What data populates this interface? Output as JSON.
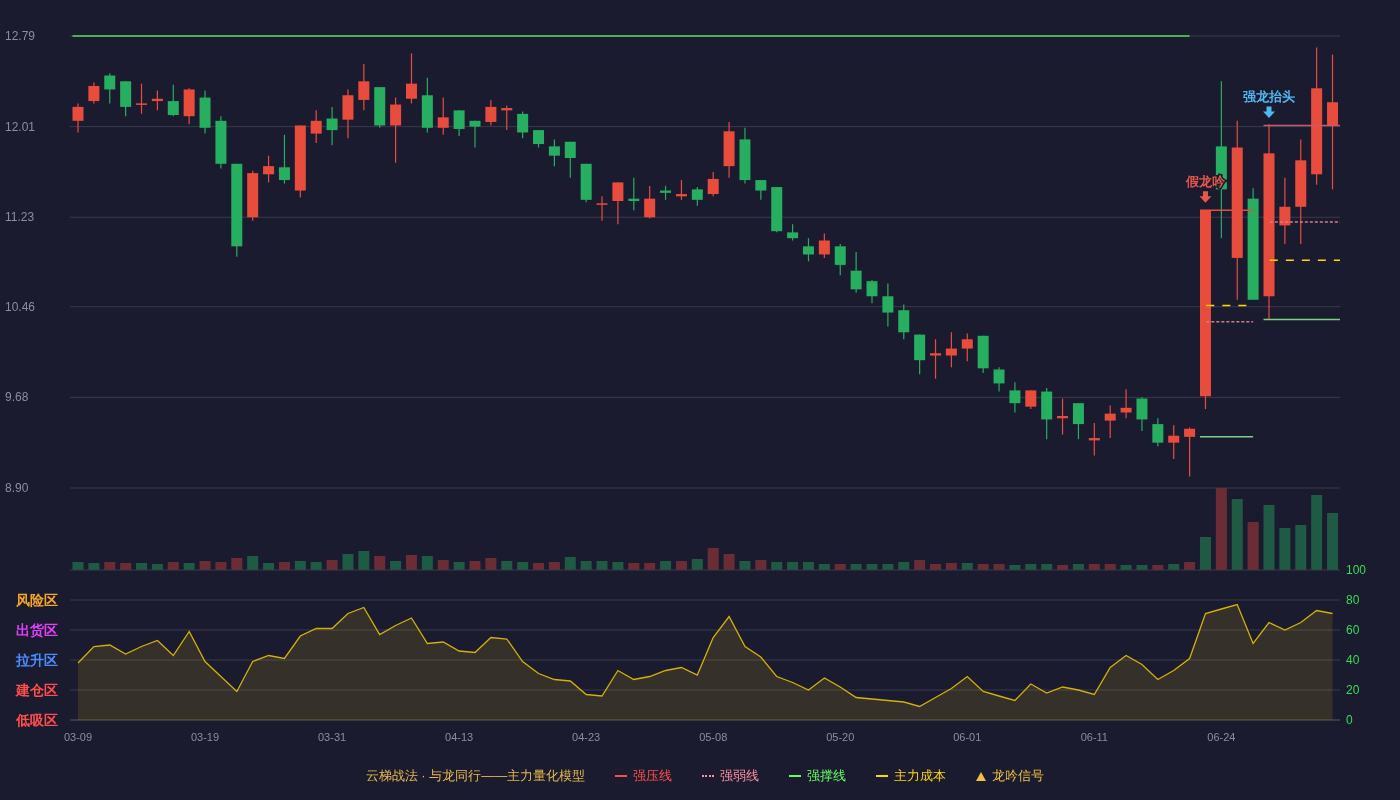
{
  "price_chart": {
    "chart_data": {
      "type": "candlestick",
      "ylim": [
        8.9,
        12.79
      ],
      "grid": true,
      "yticks": [
        {
          "value": 12.79,
          "label": "12.79"
        },
        {
          "value": 12.01,
          "label": "12.01"
        },
        {
          "value": 11.23,
          "label": "11.23"
        },
        {
          "value": 10.46,
          "label": "10.46"
        },
        {
          "value": 9.68,
          "label": "9.68"
        },
        {
          "value": 8.9,
          "label": "8.90"
        }
      ],
      "ohlc": [
        [
          12.06,
          12.21,
          11.96,
          12.18
        ],
        [
          12.23,
          12.39,
          12.21,
          12.36
        ],
        [
          12.45,
          12.47,
          12.21,
          12.33
        ],
        [
          12.4,
          12.4,
          12.1,
          12.18
        ],
        [
          12.2,
          12.38,
          12.12,
          12.21
        ],
        [
          12.23,
          12.32,
          12.15,
          12.25
        ],
        [
          12.23,
          12.37,
          12.1,
          12.11
        ],
        [
          12.1,
          12.34,
          12.03,
          12.33
        ],
        [
          12.26,
          12.32,
          11.95,
          12.0
        ],
        [
          12.06,
          12.1,
          11.65,
          11.69
        ],
        [
          11.69,
          11.69,
          10.89,
          10.98
        ],
        [
          11.23,
          11.63,
          11.2,
          11.61
        ],
        [
          11.6,
          11.76,
          11.53,
          11.67
        ],
        [
          11.66,
          11.94,
          11.52,
          11.55
        ],
        [
          11.46,
          12.02,
          11.4,
          12.02
        ],
        [
          11.95,
          12.15,
          11.87,
          12.06
        ],
        [
          12.08,
          12.18,
          11.85,
          11.98
        ],
        [
          12.07,
          12.33,
          11.91,
          12.28
        ],
        [
          12.24,
          12.55,
          12.15,
          12.4
        ],
        [
          12.35,
          12.35,
          12.0,
          12.02
        ],
        [
          12.02,
          12.26,
          11.7,
          12.2
        ],
        [
          12.25,
          12.64,
          12.21,
          12.38
        ],
        [
          12.28,
          12.43,
          11.96,
          12.0
        ],
        [
          12.0,
          12.26,
          11.94,
          12.09
        ],
        [
          12.15,
          12.15,
          11.93,
          11.99
        ],
        [
          12.06,
          12.06,
          11.83,
          12.01
        ],
        [
          12.05,
          12.24,
          12.02,
          12.18
        ],
        [
          12.15,
          12.19,
          11.98,
          12.17
        ],
        [
          12.12,
          12.14,
          11.91,
          11.96
        ],
        [
          11.98,
          11.98,
          11.83,
          11.86
        ],
        [
          11.84,
          11.9,
          11.67,
          11.76
        ],
        [
          11.88,
          11.88,
          11.57,
          11.74
        ],
        [
          11.69,
          11.69,
          11.36,
          11.38
        ],
        [
          11.34,
          11.41,
          11.2,
          11.35
        ],
        [
          11.37,
          11.53,
          11.17,
          11.53
        ],
        [
          11.39,
          11.57,
          11.29,
          11.37
        ],
        [
          11.23,
          11.5,
          11.22,
          11.39
        ],
        [
          11.46,
          11.5,
          11.38,
          11.44
        ],
        [
          11.41,
          11.55,
          11.38,
          11.43
        ],
        [
          11.47,
          11.49,
          11.33,
          11.38
        ],
        [
          11.43,
          11.62,
          11.41,
          11.56
        ],
        [
          11.67,
          12.05,
          11.57,
          11.97
        ],
        [
          11.9,
          12.0,
          11.52,
          11.55
        ],
        [
          11.55,
          11.55,
          11.38,
          11.46
        ],
        [
          11.49,
          11.49,
          11.1,
          11.11
        ],
        [
          11.1,
          11.17,
          11.03,
          11.05
        ],
        [
          10.98,
          11.05,
          10.85,
          10.91
        ],
        [
          10.91,
          11.09,
          10.88,
          11.03
        ],
        [
          10.98,
          11.0,
          10.73,
          10.82
        ],
        [
          10.77,
          10.93,
          10.58,
          10.61
        ],
        [
          10.68,
          10.69,
          10.49,
          10.55
        ],
        [
          10.55,
          10.66,
          10.29,
          10.41
        ],
        [
          10.43,
          10.48,
          10.18,
          10.24
        ],
        [
          10.22,
          10.22,
          9.88,
          10.0
        ],
        [
          10.04,
          10.18,
          9.84,
          10.06
        ],
        [
          10.04,
          10.24,
          9.94,
          10.1
        ],
        [
          10.1,
          10.23,
          9.99,
          10.18
        ],
        [
          10.21,
          10.21,
          9.89,
          9.93
        ],
        [
          9.92,
          9.94,
          9.73,
          9.8
        ],
        [
          9.74,
          9.81,
          9.55,
          9.63
        ],
        [
          9.6,
          9.74,
          9.58,
          9.74
        ],
        [
          9.73,
          9.76,
          9.32,
          9.49
        ],
        [
          9.5,
          9.67,
          9.36,
          9.52
        ],
        [
          9.63,
          9.63,
          9.32,
          9.45
        ],
        [
          9.31,
          9.46,
          9.18,
          9.33
        ],
        [
          9.48,
          9.61,
          9.33,
          9.54
        ],
        [
          9.55,
          9.75,
          9.5,
          9.59
        ],
        [
          9.67,
          9.68,
          9.39,
          9.49
        ],
        [
          9.45,
          9.5,
          9.26,
          9.29
        ],
        [
          9.29,
          9.44,
          9.15,
          9.35
        ],
        [
          9.34,
          9.42,
          9.0,
          9.41
        ],
        [
          9.69,
          11.29,
          9.58,
          11.29
        ],
        [
          11.84,
          12.4,
          11.05,
          11.47
        ],
        [
          10.88,
          12.06,
          10.52,
          11.83
        ],
        [
          11.39,
          11.48,
          10.52,
          10.52
        ],
        [
          10.55,
          12.03,
          10.35,
          11.78
        ],
        [
          11.16,
          11.57,
          11.0,
          11.32
        ],
        [
          11.32,
          11.9,
          11.0,
          11.72
        ],
        [
          11.6,
          12.69,
          11.51,
          12.34
        ],
        [
          12.02,
          12.63,
          11.47,
          12.22
        ]
      ]
    },
    "signals": [
      {
        "text": "假龙吟",
        "color": "#e8574a"
      },
      {
        "text": "强龙抬头",
        "color": "#4fb8f0"
      }
    ]
  },
  "oscillator": {
    "chart_data": {
      "type": "area",
      "ylim": [
        0,
        100
      ],
      "grid": true,
      "yticks": [
        {
          "value": 100,
          "label": "100"
        },
        {
          "value": 80,
          "label": "80"
        },
        {
          "value": 60,
          "label": "60"
        },
        {
          "value": 40,
          "label": "40"
        },
        {
          "value": 20,
          "label": "20"
        },
        {
          "value": 0,
          "label": "0"
        }
      ],
      "series": [
        {
          "color": "#d4b106",
          "values": [
            38,
            49,
            50,
            44,
            49,
            53,
            43,
            59,
            39,
            29,
            19,
            39,
            43,
            41,
            56,
            61,
            61,
            71,
            75,
            57,
            63,
            68,
            51,
            52,
            46,
            45,
            55,
            54,
            39,
            31,
            27,
            26,
            17,
            16,
            33,
            27,
            29,
            33,
            35,
            30,
            55,
            69,
            49,
            42,
            29,
            25,
            20,
            28,
            22,
            15,
            14,
            13,
            12,
            9,
            15,
            21,
            29,
            19,
            16,
            13,
            24,
            18,
            22,
            20,
            17,
            35,
            43,
            37,
            27,
            33,
            41,
            71,
            74,
            77,
            51,
            65,
            60,
            65,
            73,
            71
          ]
        }
      ]
    },
    "zones": [
      {
        "label": "风险区",
        "color": "#f5a623"
      },
      {
        "label": "出货区",
        "color": "#e040fb"
      },
      {
        "label": "拉升区",
        "color": "#4a8cff"
      },
      {
        "label": "建仓区",
        "color": "#ff4d4d"
      },
      {
        "label": "低吸区",
        "color": "#ff4d4d"
      }
    ],
    "date_labels": [
      "03-09",
      "03-19",
      "03-31",
      "04-13",
      "04-23",
      "05-08",
      "05-20",
      "06-01",
      "06-11",
      "06-24"
    ]
  },
  "legend": {
    "title": "云梯战法 · 与龙同行——主力量化模型",
    "color": "#e8b84a",
    "items": [
      {
        "kind": "solid",
        "label": "强压线",
        "color": "#ff4d4d"
      },
      {
        "kind": "dotted",
        "label": "强弱线",
        "color": "#ff8fa3"
      },
      {
        "kind": "solid",
        "label": "强撑线",
        "color": "#66ff66"
      },
      {
        "kind": "dashed",
        "label": "主力成本",
        "color": "#ffd700"
      },
      {
        "kind": "triangle",
        "label": "龙吟信号",
        "color": "#f0c040"
      }
    ]
  }
}
